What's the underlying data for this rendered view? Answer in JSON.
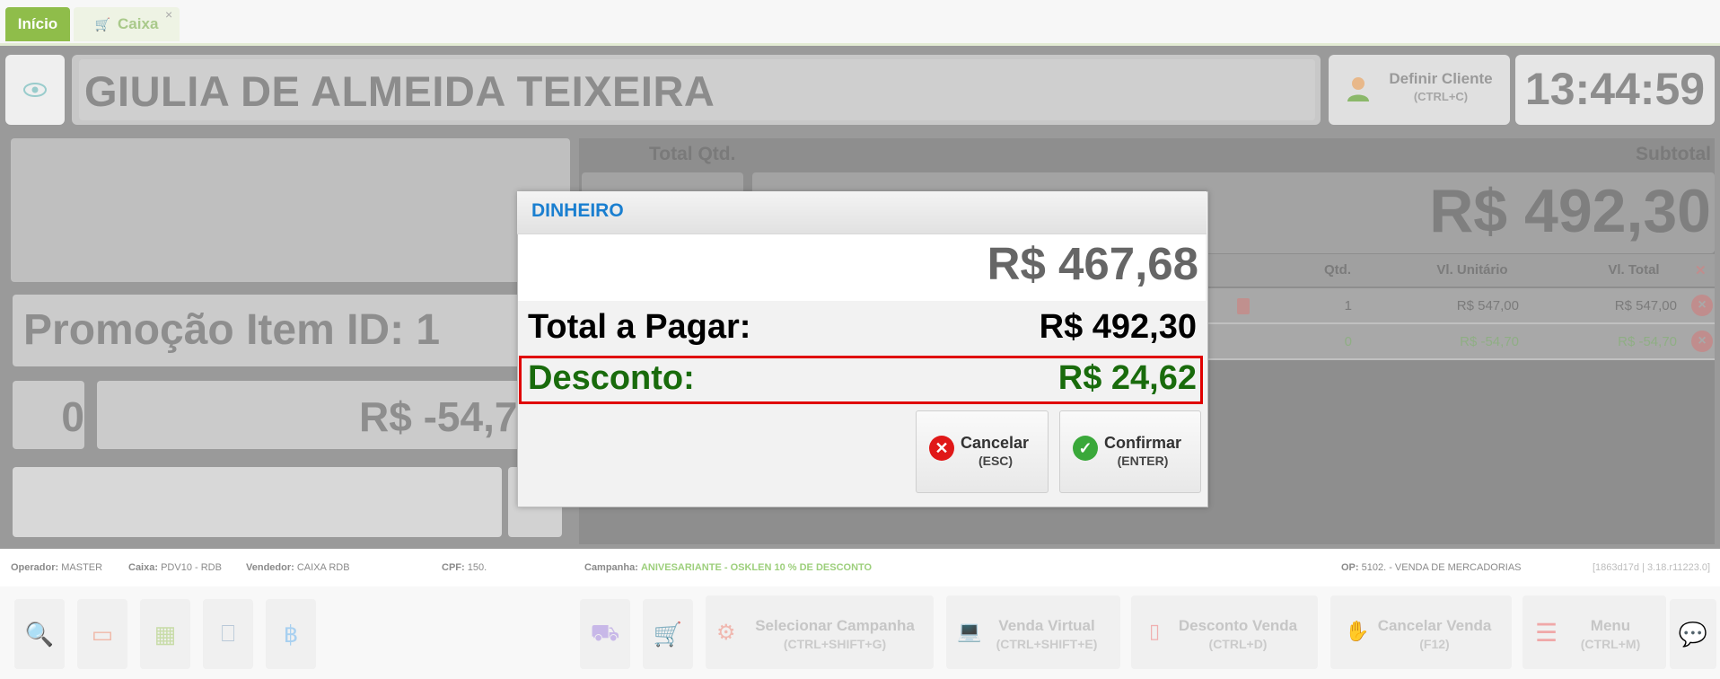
{
  "tabs": [
    {
      "label": "Início"
    },
    {
      "label": "Caixa"
    }
  ],
  "header": {
    "customer_name": "GIULIA DE ALMEIDA TEIXEIRA",
    "client_button_label": "Definir Cliente",
    "client_button_key": "(CTRL+C)",
    "clock": "13:44:59"
  },
  "left": {
    "promo_text": "Promoção Item ID: 1",
    "qty": "0",
    "price": "R$ -54,7"
  },
  "right": {
    "total_qtd_label": "Total Qtd.",
    "subtotal_label": "Subtotal",
    "subtotal_value": "R$ 492,30",
    "table": {
      "headers": [
        "Qtd.",
        "Vl. Unitário",
        "Vl. Total"
      ],
      "close_icon": "✕",
      "rows": [
        {
          "qty": "1",
          "unit": "R$ 547,00",
          "total": "R$ 547,00"
        },
        {
          "qty": "0",
          "unit": "R$ -54,70",
          "total": "R$ -54,70"
        }
      ]
    }
  },
  "status": {
    "operador_label": "Operador:",
    "operador": "MASTER",
    "caixa_label": "Caixa:",
    "caixa": "PDV10 - RDB",
    "vendedor_label": "Vendedor:",
    "vendedor": "CAIXA RDB",
    "cpf_label": "CPF:",
    "cpf": "150.",
    "campanha_label": "Campanha:",
    "campanha": "ANIVESARIANTE - OSKLEN 10 % DE DESCONTO",
    "op_label": "OP:",
    "op": "5102. - VENDA DE MERCADORIAS",
    "version": "[1863d17d | 3.18.r11223.0]"
  },
  "toolbar": {
    "campaign_label": "Selecionar Campanha",
    "campaign_key": "(CTRL+SHIFT+G)",
    "virtual_label": "Venda Virtual",
    "virtual_key": "(CTRL+SHIFT+E)",
    "discount_label": "Desconto Venda",
    "discount_key": "(CTRL+D)",
    "cancel_label": "Cancelar Venda",
    "cancel_key": "(F12)",
    "menu_label": "Menu",
    "menu_key": "(CTRL+M)"
  },
  "modal": {
    "title": "DINHEIRO",
    "amount": "R$ 467,68",
    "total_label": "Total a Pagar:",
    "total_value": "R$ 492,30",
    "discount_label": "Desconto:",
    "discount_value": "R$ 24,62",
    "cancel_label": "Cancelar",
    "cancel_key": "(ESC)",
    "confirm_label": "Confirmar",
    "confirm_key": "(ENTER)"
  },
  "colors": {
    "accent_green": "#8fbd4a",
    "modal_title": "#1a7fd0",
    "discount_green": "#196b0c",
    "highlight_red": "#e00000"
  }
}
